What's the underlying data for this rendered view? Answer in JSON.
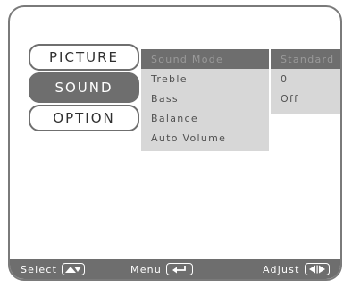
{
  "tabs": [
    {
      "label": "PICTURE",
      "active": false
    },
    {
      "label": "SOUND",
      "active": true
    },
    {
      "label": "OPTION",
      "active": false
    }
  ],
  "items": [
    {
      "label": "Sound Mode",
      "value": "Standard",
      "selected": true
    },
    {
      "label": "Treble",
      "value": "0"
    },
    {
      "label": "Bass",
      "value": "Off"
    },
    {
      "label": "Balance"
    },
    {
      "label": "Auto Volume"
    }
  ],
  "footer": {
    "select_label": "Select",
    "menu_label": "Menu",
    "adjust_label": "Adjust",
    "select_icon": "up-down-arrows-icon",
    "menu_icon": "return-icon",
    "adjust_icon": "left-right-arrows-icon"
  },
  "colors": {
    "active": "#6e6e6e",
    "panel": "#d7d7d7",
    "border": "#7a7a7a"
  }
}
